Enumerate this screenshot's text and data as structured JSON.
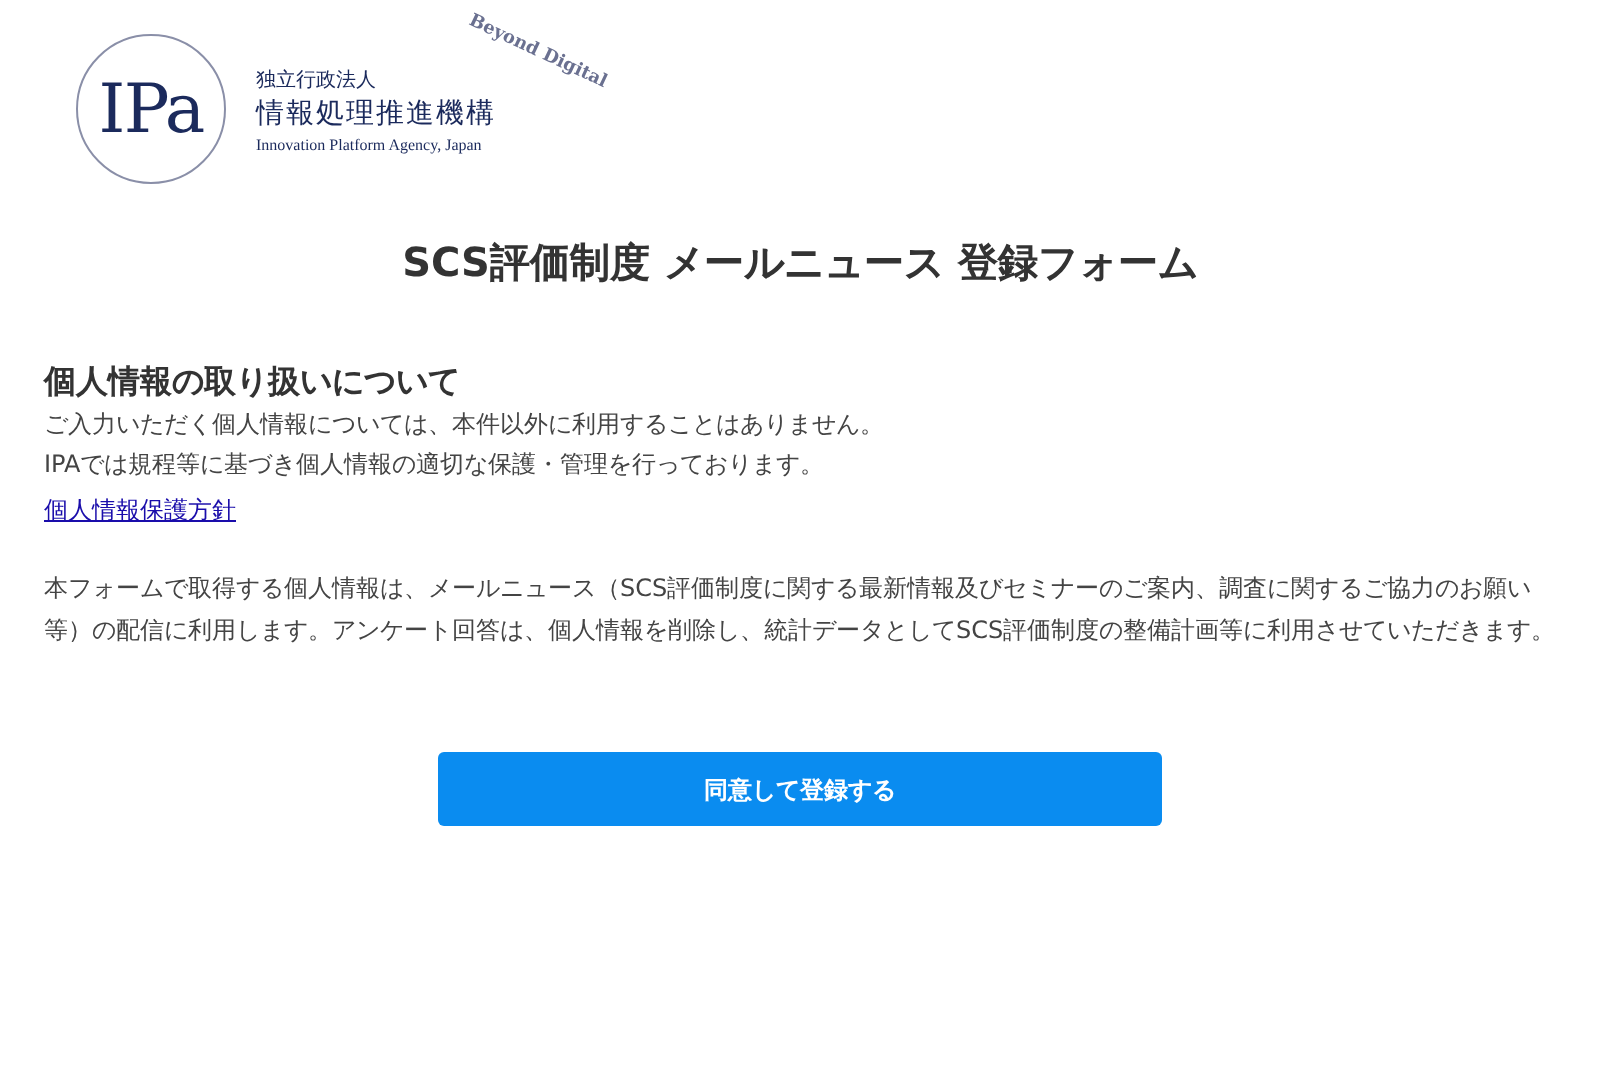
{
  "logo": {
    "mark": "IPa",
    "tagline": "Beyond Digital",
    "org_type": "独立行政法人",
    "org_name": "情報処理推進機構",
    "org_name_en": "Innovation Platform Agency, Japan"
  },
  "title": "SCS評価制度 メールニュース 登録フォーム",
  "privacy": {
    "heading": "個人情報の取り扱いについて",
    "lines": [
      "ご入力いただく個人情報については、本件以外に利用することはありません。",
      "IPAでは規程等に基づき個人情報の適切な保護・管理を行っております。"
    ],
    "link": "個人情報保護方針"
  },
  "notice": "本フォームで取得する個人情報は、メールニュース（SCS評価制度に関する最新情報及びセミナーのご案内、調査に関するご協力のお願い等）の配信に利用します。アンケート回答は、個人情報を削除し、統計データとしてSCS評価制度の整備計画等に利用させていただきます。",
  "submit_button": "同意して登録する"
}
